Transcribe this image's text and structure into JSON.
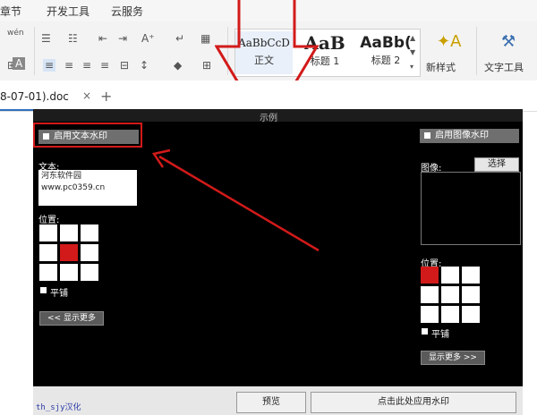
{
  "menu": {
    "items": [
      "章节",
      "开发工具",
      "云服务"
    ]
  },
  "ribbon": {
    "styles": [
      {
        "preview": "AaBbCcD",
        "name": "正文"
      },
      {
        "preview": "AaB",
        "name": "标题 1"
      },
      {
        "preview": "AaBb(",
        "name": "标题 2"
      }
    ],
    "new_style_label": "新样式",
    "text_tools_label": "文字工具"
  },
  "doc_tab": {
    "title": "8-07-01).doc",
    "close": "×",
    "new_tab": "+"
  },
  "dialog": {
    "title": "示例",
    "text_watermark": {
      "enable_label": "启用文本水印",
      "text_label": "文本:",
      "text_value": [
        "河东软件园",
        "www.pc0359.cn"
      ],
      "position_label": "位置:",
      "selected_cell": 4,
      "tile_label": "平铺",
      "show_more_label": "<< 显示更多"
    },
    "image_watermark": {
      "enable_label": "启用图像水印",
      "image_label": "图像:",
      "select_label": "选择",
      "position_label": "位置:",
      "selected_cell": 0,
      "tile_label": "平铺",
      "show_more_label": "显示更多 >>"
    },
    "author_label": "th_sjy汉化",
    "preview_label": "预览",
    "apply_label": "点击此处应用水印"
  },
  "colors": {
    "highlight": "#d21a1a",
    "dialog_bg": "#000000",
    "tab_accent": "#2f6fbd"
  }
}
